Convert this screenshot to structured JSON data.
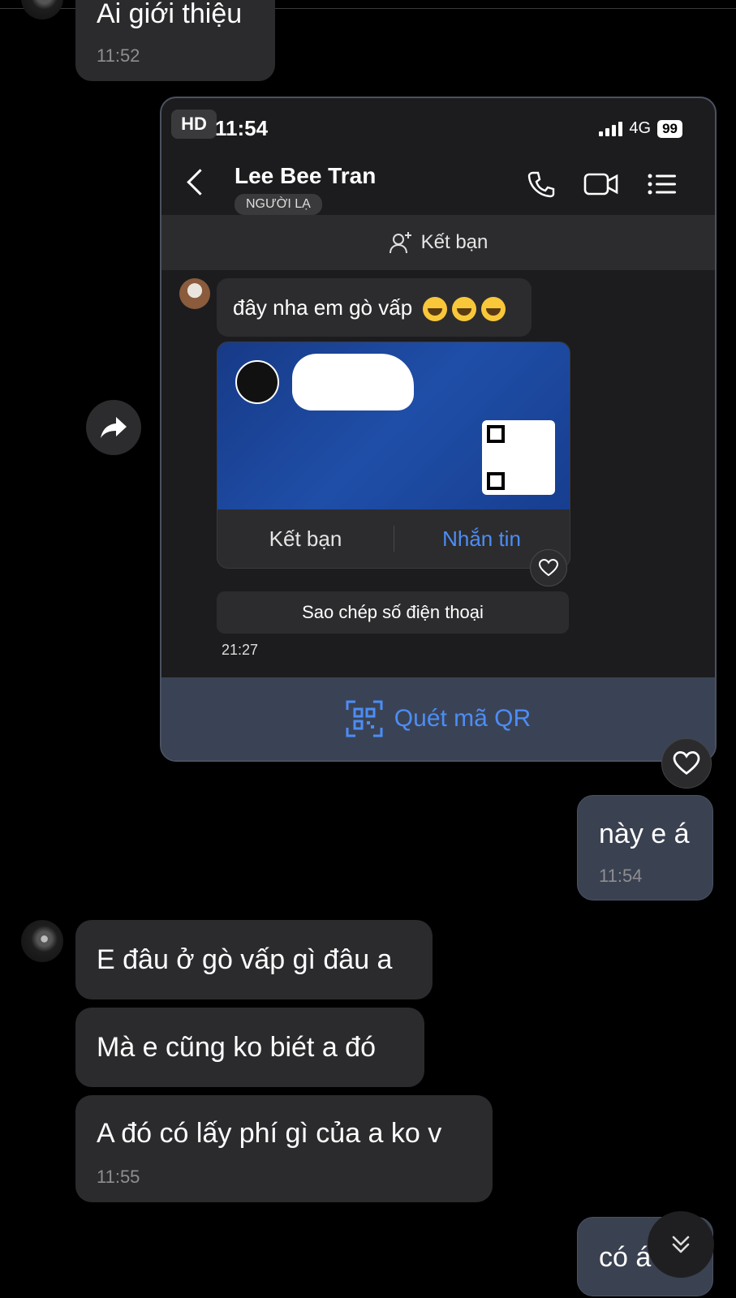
{
  "messages": {
    "m1": {
      "text": "Ai giới thiệu",
      "time": "11:52"
    },
    "m2": {
      "text": "này e á",
      "time": "11:54"
    },
    "m3": {
      "text": "E đâu ở gò vấp gì đâu a"
    },
    "m4": {
      "text": "Mà e cũng ko biét a đó"
    },
    "m5": {
      "text": "A đó có lấy phí gì của a ko v",
      "time": "11:55"
    },
    "m6": {
      "text": "có á"
    }
  },
  "screenshot": {
    "hd_label": "HD",
    "clock": "11:54",
    "network": "4G",
    "battery": "99",
    "contact_name": "Lee Bee Tran",
    "stranger_tag": "NGƯỜI LẠ",
    "add_friend_bar": "Kết bạn",
    "message": "đây nha em gò vấp",
    "card": {
      "add_friend": "Kết bạn",
      "message_btn": "Nhắn tin"
    },
    "copy_phone": "Sao chép số điện thoại",
    "time": "21:27",
    "scan_qr": "Quét mã QR"
  },
  "colors": {
    "accent": "#4c8df6",
    "bubble_in": "#2b2b2d",
    "bubble_out": "#3a4150"
  }
}
